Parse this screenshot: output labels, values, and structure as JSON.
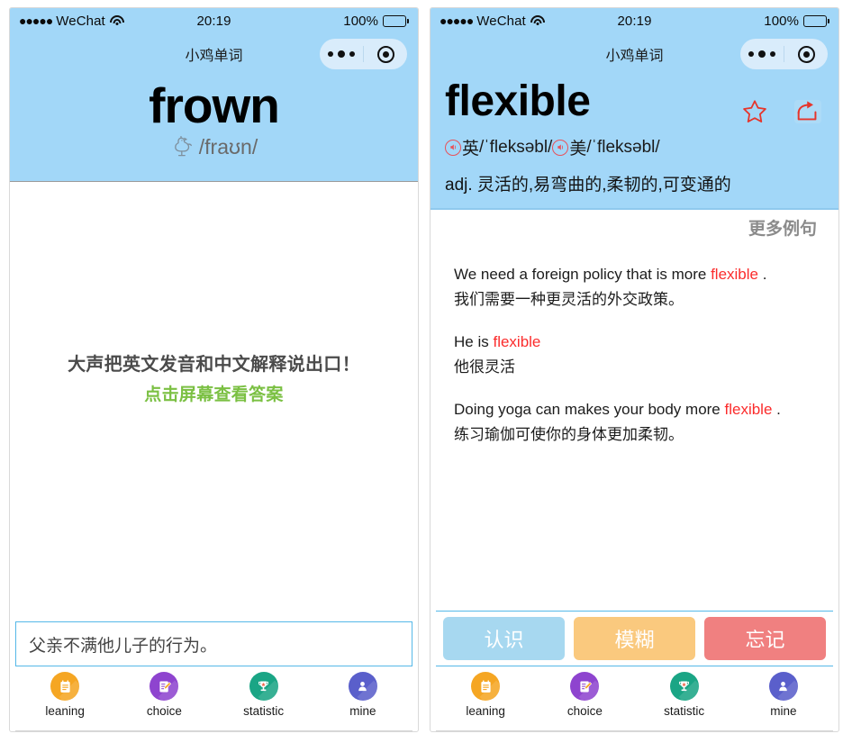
{
  "statusbar": {
    "signal_dots": "●●●●●",
    "carrier": "WeChat",
    "wifi_icon": "wifi-icon",
    "time": "20:19",
    "battery_percent": "100%",
    "battery_icon": "battery-full-icon"
  },
  "navbar": {
    "title": "小鸡单词",
    "more_icon": "more-dots-icon",
    "target_icon": "target-circle-icon"
  },
  "left_panel": {
    "word": "frown",
    "phonetic": "/fraʊn/",
    "pronounce_icon": "chicken-speaker-icon",
    "hint_line1": "大声把英文发音和中文解释说出口！",
    "hint_line2": "点击屏幕查看答案",
    "answer_value": "父亲不满他儿子的行为。"
  },
  "right_panel": {
    "word": "flexible",
    "star_icon": "star-outline-icon",
    "share_icon": "share-arrow-icon",
    "uk_speaker_icon": "speaker-uk-icon",
    "uk_label": "英",
    "uk_phonetic": "/ˈfleksəbl/",
    "us_speaker_icon": "speaker-us-icon",
    "us_label": "美",
    "us_phonetic": "/ˈfleksəbl/",
    "definition": "adj. 灵活的,易弯曲的,柔韧的,可变通的",
    "more_examples_title": "更多例句",
    "sentences": [
      {
        "en_before": "We need a foreign policy that is more ",
        "en_word": "flexible",
        "en_after": " .",
        "zh": "我们需要一种更灵活的外交政策。"
      },
      {
        "en_before": "He is ",
        "en_word": "flexible",
        "en_after": "",
        "zh": "他很灵活"
      },
      {
        "en_before": "Doing yoga can makes your body more ",
        "en_word": "flexible",
        "en_after": " .",
        "zh": "练习瑜伽可使你的身体更加柔韧。"
      }
    ],
    "grade_buttons": [
      {
        "label": "认识",
        "color": "#a7d8f0"
      },
      {
        "label": "模糊",
        "color": "#fac97e"
      },
      {
        "label": "忘记",
        "color": "#f08080"
      }
    ]
  },
  "tabbar": {
    "items": [
      {
        "label": "leaning",
        "icon": "notepad-icon",
        "color": "#f5a623"
      },
      {
        "label": "choice",
        "icon": "edit-doc-icon",
        "color": "#8e44cf"
      },
      {
        "label": "statistic",
        "icon": "trophy-icon",
        "color": "#1aa585"
      },
      {
        "label": "mine",
        "icon": "person-icon",
        "color": "#5a5fcb"
      }
    ]
  },
  "theme": {
    "header_blue": "#a2d7f8",
    "accent_green": "#7bc043",
    "highlight_red": "#fb2c2c",
    "border_blue": "#55b8e8"
  }
}
